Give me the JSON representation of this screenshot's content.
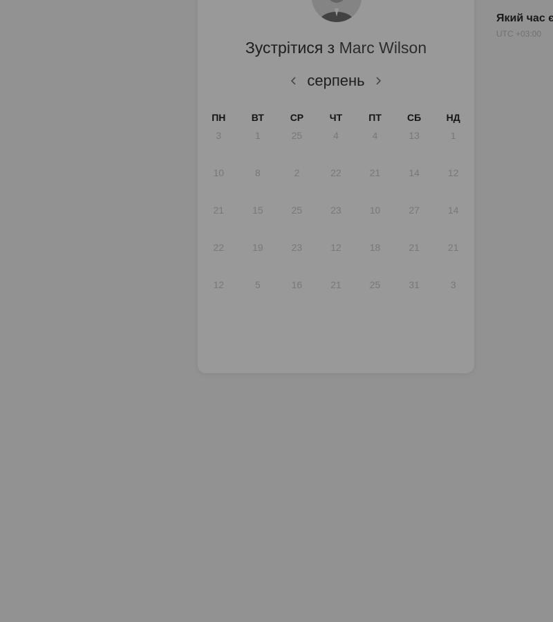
{
  "scheduler": {
    "title_prefix": "Зустрітися з",
    "host_name": "Marc Wilson",
    "month": "серпень",
    "prev_month_icon": "chevron-left-icon",
    "next_month_icon": "chevron-right-icon",
    "weekdays": [
      "ПН",
      "ВТ",
      "СР",
      "ЧТ",
      "ПТ",
      "СБ",
      "НД"
    ],
    "days": [
      "3",
      "1",
      "25",
      "4",
      "4",
      "13",
      "1",
      "10",
      "8",
      "2",
      "22",
      "21",
      "14",
      "12",
      "21",
      "15",
      "25",
      "23",
      "10",
      "27",
      "14",
      "22",
      "19",
      "23",
      "12",
      "18",
      "21",
      "21",
      "12",
      "5",
      "16",
      "21",
      "25",
      "31",
      "3"
    ]
  },
  "side_panel": {
    "title": "Який час є",
    "subtitle": "UTC +03:00"
  },
  "colors": {
    "overlay": "#000000",
    "overlay_opacity": "0.4",
    "card_bg": "#ffffff",
    "page_bg": "#f4f4f4"
  }
}
